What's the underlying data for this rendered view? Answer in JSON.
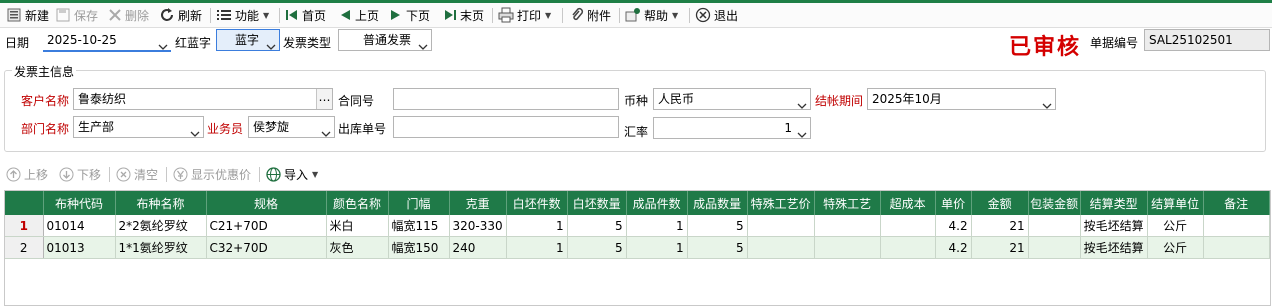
{
  "toolbar": {
    "new": "新建",
    "save": "保存",
    "delete": "删除",
    "refresh": "刷新",
    "function": "功能",
    "first": "首页",
    "prev": "上页",
    "next": "下页",
    "last": "末页",
    "print": "打印",
    "attach": "附件",
    "help": "帮助",
    "exit": "退出"
  },
  "header": {
    "date_label": "日期",
    "date_value": "2025-10-25",
    "redblue_label": "红蓝字",
    "redblue_value": "蓝字",
    "invoice_type_label": "发票类型",
    "invoice_type_value": "普通发票",
    "stamp": "已审核",
    "docno_label": "单据编号",
    "docno_value": "SAL25102501"
  },
  "invoice_info": {
    "group_title": "发票主信息",
    "customer_label": "客户名称",
    "customer_value": "鲁泰纺织",
    "ellipsis": "…",
    "contract_label": "合同号",
    "contract_value": "",
    "currency_label": "币种",
    "currency_value": "人民币",
    "period_label": "结帐期间",
    "period_value": "2025年10月",
    "dept_label": "部门名称",
    "dept_value": "生产部",
    "salesman_label": "业务员",
    "salesman_value": "侯梦旋",
    "outbound_label": "出库单号",
    "outbound_value": "",
    "rate_label": "汇率",
    "rate_value": "1"
  },
  "detail_toolbar": {
    "up": "上移",
    "down": "下移",
    "clear": "清空",
    "discount": "显示优惠价",
    "import": "导入"
  },
  "grid": {
    "columns": [
      "",
      "布种代码",
      "布种名称",
      "规格",
      "颜色名称",
      "门幅",
      "克重",
      "白坯件数",
      "白坯数量",
      "成品件数",
      "成品数量",
      "特殊工艺价",
      "特殊工艺",
      "超成本",
      "单价",
      "金额",
      "包装金额",
      "结算类型",
      "结算单位",
      "备注"
    ],
    "rows": [
      [
        "1",
        "01014",
        "2*2氨纶罗纹",
        "C21+70D",
        "米白",
        "幅宽115",
        "320-330",
        "1",
        "5",
        "1",
        "5",
        "",
        "",
        "",
        "4.2",
        "21",
        "",
        "按毛坯结算",
        "公斤",
        ""
      ],
      [
        "2",
        "01013",
        "1*1氨纶罗纹",
        "C32+70D",
        "灰色",
        "幅宽150",
        "240",
        "1",
        "5",
        "1",
        "5",
        "",
        "",
        "",
        "4.2",
        "21",
        "",
        "按毛坯结算",
        "公斤",
        ""
      ]
    ]
  },
  "colors": {
    "accent": "#1f7a48",
    "required_label": "#c00000",
    "stamp": "#d40000"
  }
}
